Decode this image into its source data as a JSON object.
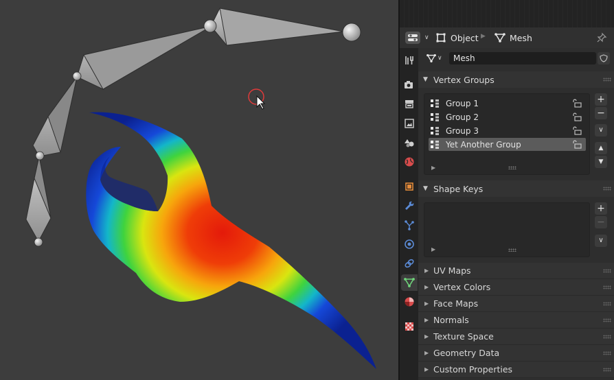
{
  "header": {
    "object_label": "Object",
    "mesh_label": "Mesh"
  },
  "mesh_datablock": {
    "name": "Mesh"
  },
  "vertex_groups": {
    "title": "Vertex Groups",
    "items": [
      {
        "label": "Group 1",
        "selected": false
      },
      {
        "label": "Group 2",
        "selected": false
      },
      {
        "label": "Group 3",
        "selected": false
      },
      {
        "label": "Yet Another Group",
        "selected": true
      }
    ],
    "buttons": {
      "add": "+",
      "remove": "−"
    }
  },
  "shape_keys": {
    "title": "Shape Keys",
    "buttons": {
      "add": "+",
      "remove": "−"
    }
  },
  "collapsed_panels": [
    {
      "label": "UV Maps"
    },
    {
      "label": "Vertex Colors"
    },
    {
      "label": "Face Maps"
    },
    {
      "label": "Normals"
    },
    {
      "label": "Texture Space"
    },
    {
      "label": "Geometry Data"
    },
    {
      "label": "Custom Properties"
    }
  ],
  "property_tabs": [
    {
      "icon": "tool-icon",
      "active": false
    },
    {
      "icon": "render-icon",
      "active": false
    },
    {
      "icon": "output-icon",
      "active": false
    },
    {
      "icon": "view-layer-icon",
      "active": false
    },
    {
      "icon": "scene-icon",
      "active": false
    },
    {
      "icon": "world-icon",
      "active": false
    },
    {
      "icon": "object-icon",
      "active": false
    },
    {
      "icon": "modifier-wrench-icon",
      "active": false
    },
    {
      "icon": "particles-icon",
      "active": false
    },
    {
      "icon": "physics-icon",
      "active": false
    },
    {
      "icon": "constraints-icon",
      "active": false
    },
    {
      "icon": "mesh-data-icon",
      "active": true
    },
    {
      "icon": "material-icon",
      "active": false
    },
    {
      "icon": "texture-icon",
      "active": false
    }
  ],
  "colors": {
    "viewport_bg": "#3d3d3d",
    "selection": "#5b5b5b",
    "weight_low": "#0a1f8c",
    "weight_high": "#e01b0b"
  }
}
